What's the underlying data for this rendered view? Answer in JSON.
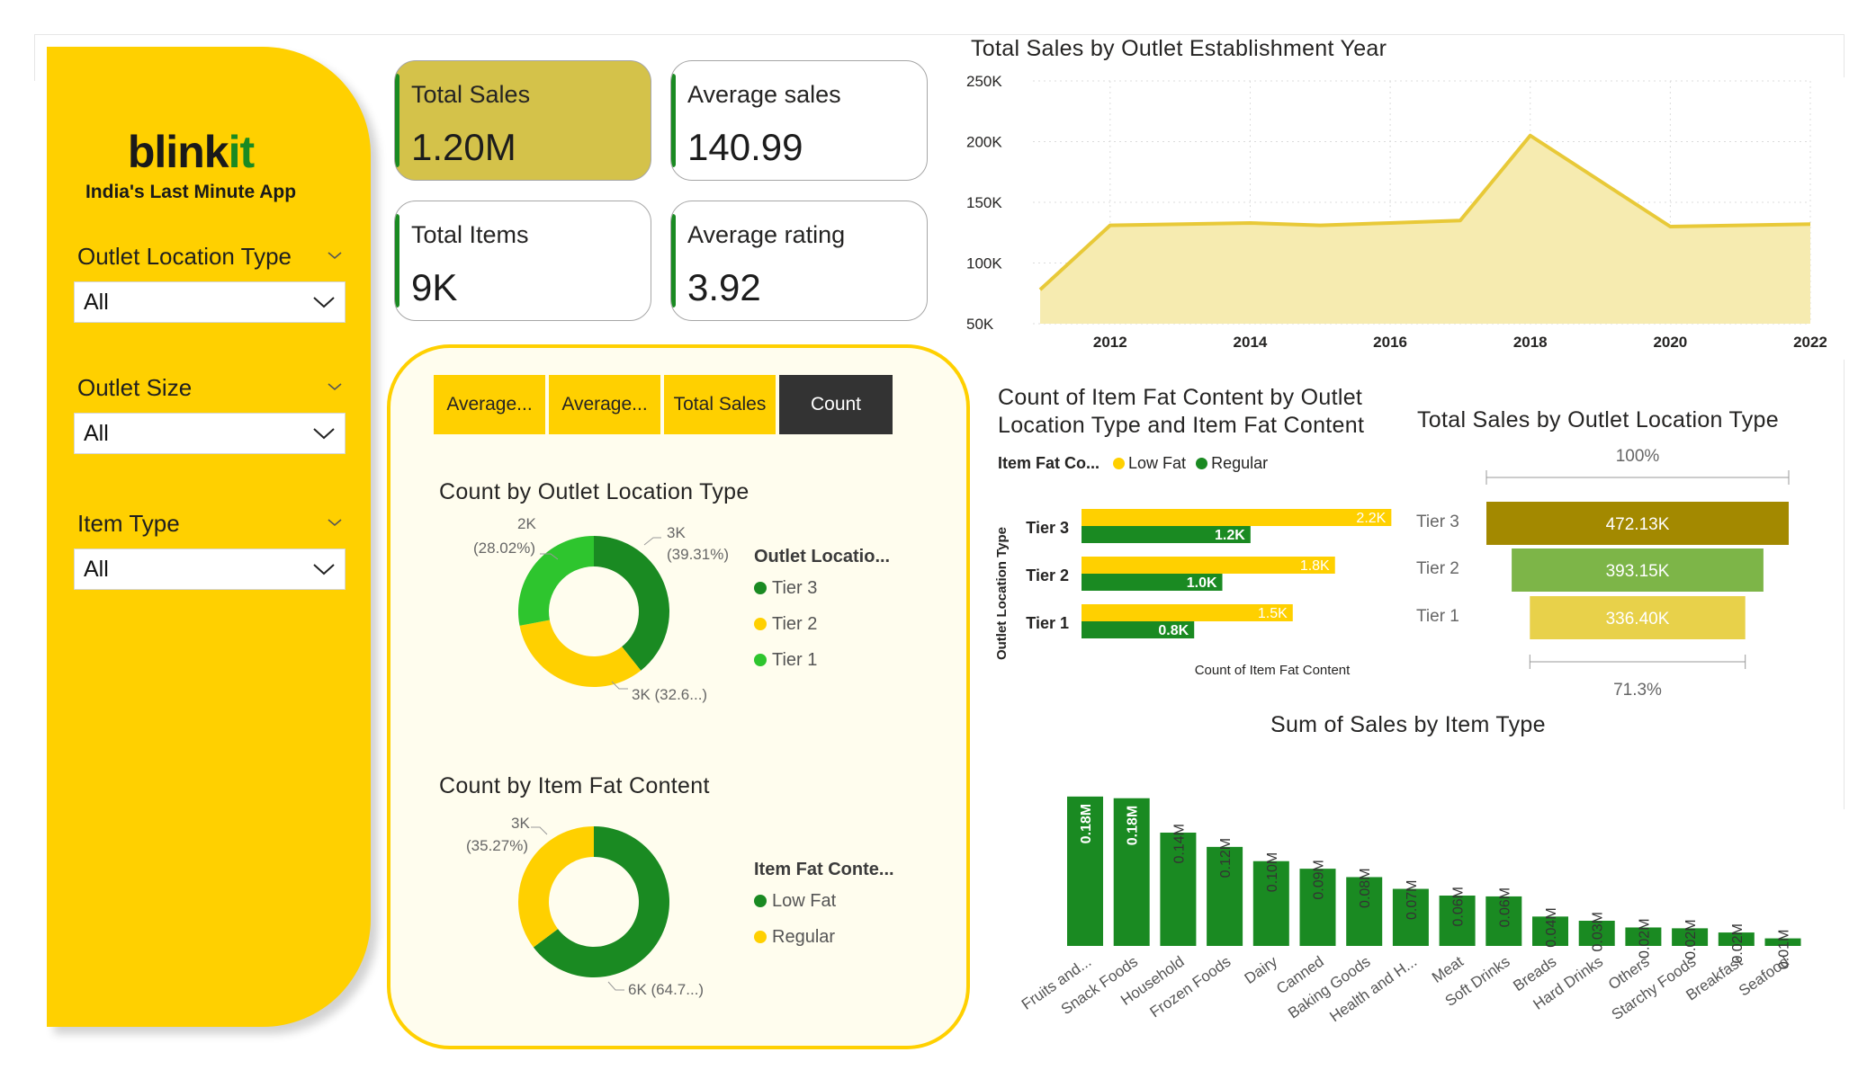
{
  "brand": {
    "name_main": "blink",
    "name_accent": "it",
    "tagline": "India's Last Minute App"
  },
  "filters": [
    {
      "label": "Outlet Location Type",
      "value": "All"
    },
    {
      "label": "Outlet Size",
      "value": "All"
    },
    {
      "label": "Item Type",
      "value": "All"
    }
  ],
  "kpis": [
    {
      "label": "Total Sales",
      "value": "1.20M"
    },
    {
      "label": "Average sales",
      "value": "140.99"
    },
    {
      "label": "Total Items",
      "value": "9K"
    },
    {
      "label": "Average rating",
      "value": "3.92"
    }
  ],
  "tabs": [
    "Average...",
    "Average...",
    "Total Sales",
    "Count"
  ],
  "colors": {
    "yellow": "#FFD000",
    "green": "#1a8a22",
    "light_green": "#2ec52e",
    "dark": "#333333"
  },
  "chart_data": [
    {
      "id": "area",
      "type": "area",
      "title": "Total Sales by Outlet Establishment Year",
      "x": [
        2011,
        2012,
        2014,
        2015,
        2016,
        2017,
        2018,
        2020,
        2022
      ],
      "y": [
        78000,
        131000,
        133000,
        131000,
        133000,
        135000,
        205000,
        130000,
        132000
      ],
      "xticks": [
        "2012",
        "2014",
        "2016",
        "2018",
        "2020",
        "2022"
      ],
      "yticks": [
        "250K",
        "200K",
        "150K",
        "100K",
        "50K"
      ],
      "ylim": [
        50000,
        250000
      ],
      "grid": true
    },
    {
      "id": "donut_location",
      "type": "pie",
      "title": "Count by Outlet Location Type",
      "legend_title": "Outlet Locatio...",
      "labels": [
        "Tier 3",
        "Tier 2",
        "Tier 1"
      ],
      "values": [
        39.31,
        32.66,
        28.02
      ],
      "data_labels": [
        [
          "3K",
          "(39.31%)"
        ],
        [
          "3K (32.6...)"
        ],
        [
          "2K",
          "(28.02%)"
        ]
      ],
      "colors": [
        "#1a8a22",
        "#FFD000",
        "#2ec52e"
      ]
    },
    {
      "id": "donut_fat",
      "type": "pie",
      "title": "Count by Item Fat Content",
      "legend_title": "Item Fat Conte...",
      "labels": [
        "Low Fat",
        "Regular"
      ],
      "values": [
        64.73,
        35.27
      ],
      "data_labels": [
        [
          "6K (64.7...)"
        ],
        [
          "3K",
          "(35.27%)"
        ]
      ],
      "colors": [
        "#1a8a22",
        "#FFD000"
      ]
    },
    {
      "id": "fat_bars",
      "type": "bar",
      "title": "Count of Item Fat Content by Outlet Location Type and Item Fat Content",
      "title_lines": [
        "Count of Item Fat Content by Outlet",
        "Location Type and Item Fat Content"
      ],
      "legend_title": "Item Fat Co...",
      "categories": [
        "Tier 3",
        "Tier 2",
        "Tier 1"
      ],
      "series": [
        {
          "name": "Low Fat",
          "values": [
            2.2,
            1.8,
            1.5
          ],
          "labels": [
            "2.2K",
            "1.8K",
            "1.5K"
          ]
        },
        {
          "name": "Regular",
          "values": [
            1.2,
            1.0,
            0.8
          ],
          "labels": [
            "1.2K",
            "1.0K",
            "0.8K"
          ]
        }
      ],
      "xlabel": "Count of Item Fat Content",
      "ylabel": "Outlet Location Type"
    },
    {
      "id": "funnel",
      "type": "bar",
      "title": "Total Sales by Outlet Location Type",
      "categories": [
        "Tier 3",
        "Tier 2",
        "Tier 1"
      ],
      "values": [
        472.13,
        393.15,
        336.4
      ],
      "labels": [
        "472.13K",
        "393.15K",
        "336.40K"
      ],
      "colors": [
        "#A38900",
        "#7DB548",
        "#E8D14A"
      ],
      "top_pct": "100%",
      "bottom_pct": "71.3%"
    },
    {
      "id": "item_type",
      "type": "bar",
      "title": "Sum of Sales by Item Type",
      "categories": [
        "Fruits and...",
        "Snack Foods",
        "Household",
        "Frozen Foods",
        "Dairy",
        "Canned",
        "Baking Goods",
        "Health and H...",
        "Meat",
        "Soft Drinks",
        "Breads",
        "Hard Drinks",
        "Others",
        "Starchy Foods",
        "Breakfast",
        "Seafood"
      ],
      "values": [
        0.178,
        0.176,
        0.135,
        0.118,
        0.101,
        0.092,
        0.082,
        0.068,
        0.06,
        0.059,
        0.035,
        0.03,
        0.022,
        0.021,
        0.016,
        0.009
      ],
      "labels": [
        "0.18M",
        "0.18M",
        "0.14M",
        "0.12M",
        "0.10M",
        "0.09M",
        "0.08M",
        "0.07M",
        "0.06M",
        "0.06M",
        "0.04M",
        "0.03M",
        "0.02M",
        "0.02M",
        "0.02M",
        "0.01M"
      ]
    }
  ]
}
